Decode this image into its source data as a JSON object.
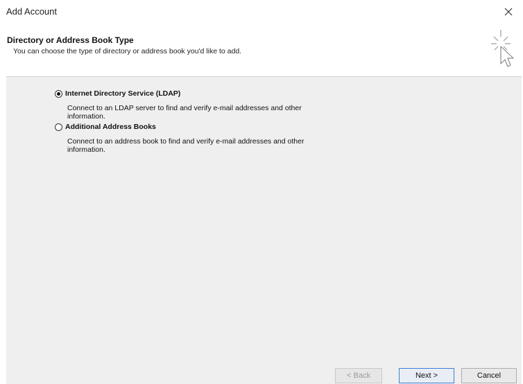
{
  "window": {
    "title": "Add Account",
    "close_icon": "close-icon"
  },
  "header": {
    "title": "Directory or Address Book Type",
    "subtitle": "You can choose the type of directory or address book you'd like to add.",
    "icon": "wizard-pointer-icon"
  },
  "options": [
    {
      "label": "Internet Directory Service (LDAP)",
      "description_line1": "Connect to an LDAP server to find and verify e-mail addresses and other",
      "description_line2": "information.",
      "selected": true
    },
    {
      "label": "Additional Address Books",
      "description_line1": "Connect to an address book to find and verify e-mail addresses and other",
      "description_line2": "information.",
      "selected": false
    }
  ],
  "buttons": {
    "back": "< Back",
    "next": "Next >",
    "cancel": "Cancel"
  }
}
